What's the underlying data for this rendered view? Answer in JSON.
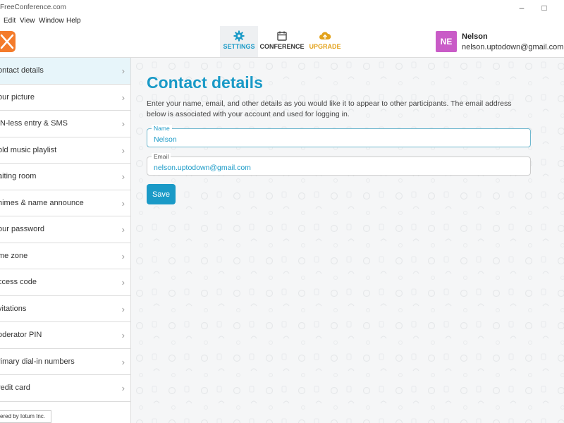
{
  "window": {
    "title": "FreeConference.com"
  },
  "menu": [
    "Edit",
    "View",
    "Window",
    "Help"
  ],
  "topnav": {
    "settings": "SETTINGS",
    "conference": "CONFERENCE",
    "upgrade": "UPGRADE",
    "colors": {
      "accent": "#1a9ac7",
      "upgrade": "#e3a21a",
      "logo": "#f47b2a"
    }
  },
  "user": {
    "initials": "NE",
    "name": "Nelson",
    "email": "nelson.uptodown@gmail.com",
    "avatar_color": "#c95bc7"
  },
  "sidebar": {
    "items": [
      "ontact details",
      "our picture",
      "IN-less entry & SMS",
      "old music playlist",
      "aiting room",
      "himes & name announce",
      "our password",
      "me zone",
      "ccess code",
      "vitations",
      "oderator PIN",
      "rimary dial-in numbers",
      "redit card"
    ],
    "powered": "ered by Iotum Inc."
  },
  "main": {
    "title": "Contact details",
    "description": "Enter your name, email, and other details as you would like it to appear to other participants. The email address below is associated with your account and used for logging in.",
    "name_label": "Name",
    "name_value": "Nelson",
    "email_label": "Email",
    "email_value": "nelson.uptodown@gmail.com",
    "save": "Save"
  }
}
